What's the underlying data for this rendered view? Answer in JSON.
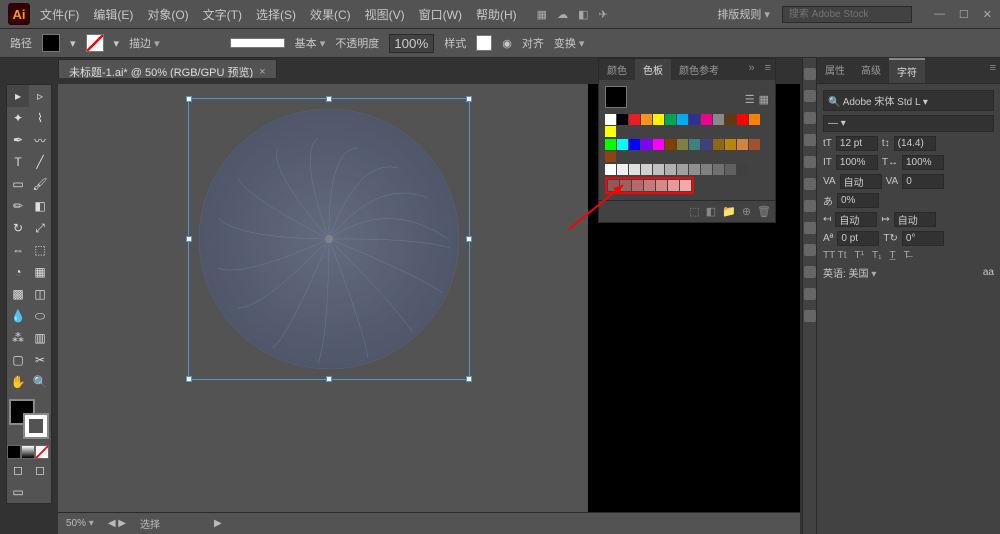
{
  "app": {
    "logo": "Ai"
  },
  "menu": [
    "文件(F)",
    "编辑(E)",
    "对象(O)",
    "文字(T)",
    "选择(S)",
    "效果(C)",
    "视图(V)",
    "窗口(W)",
    "帮助(H)"
  ],
  "topbar": {
    "workspace_label": "排版规则",
    "search_placeholder": "搜索 Adobe Stock"
  },
  "optbar": {
    "path_label": "路径",
    "stroke_label": "描边",
    "basic_label": "基本",
    "opacity_label": "不透明度",
    "opacity_value": "100%",
    "style_label": "样式",
    "align_label": "对齐",
    "transform_label": "变换"
  },
  "tab": {
    "title": "未标题-1.ai* @ 50% (RGB/GPU 预览)",
    "close": "×"
  },
  "status": {
    "zoom": "50%",
    "selection_label": "选择",
    "nav": "◀  ▶"
  },
  "swatches_panel": {
    "tabs": [
      "颜色",
      "色板",
      "颜色参考"
    ],
    "active_tab": 1,
    "colors_row1": [
      "#ffffff",
      "#000000",
      "#ed1c24",
      "#f7941d",
      "#fff200",
      "#00a651",
      "#00aeef",
      "#2e3192",
      "#ec008c",
      "#898989",
      "#603913",
      "#ff0000",
      "#ff8000",
      "#ffff00"
    ],
    "colors_row2": [
      "#00ff00",
      "#00ffff",
      "#0000ff",
      "#8000ff",
      "#ff00ff",
      "#804000",
      "#808040",
      "#408080",
      "#404080",
      "#8b6914",
      "#b8860b",
      "#cd853f",
      "#a0522d",
      "#8b4513"
    ],
    "grays": [
      "#ffffff",
      "#f0f0f0",
      "#e0e0e0",
      "#d0d0d0",
      "#c0c0c0",
      "#b0b0b0",
      "#a0a0a0",
      "#909090",
      "#808080",
      "#707070",
      "#606060",
      "#404040"
    ],
    "highlighted": [
      "#8b5a5a",
      "#a06060",
      "#b56b6b",
      "#c97878",
      "#d98888",
      "#e89999",
      "#f5aaaa"
    ]
  },
  "char_panel": {
    "tabs": [
      "属性",
      "高级",
      "字符"
    ],
    "active_tab": 2,
    "font": "Adobe 宋体 Std L",
    "size_label": "",
    "size": "12 pt",
    "leading": "(14.4)",
    "tracking1": "100%",
    "tracking2": "100%",
    "va1": "自动",
    "va2": "0",
    "kern_label": "0%",
    "auto1": "自动",
    "auto2": "自动",
    "baseline": "0 pt",
    "rotation": "0°",
    "caps": "TT  Tt",
    "lang_label": "英语: 美国",
    "anti": "aa"
  }
}
